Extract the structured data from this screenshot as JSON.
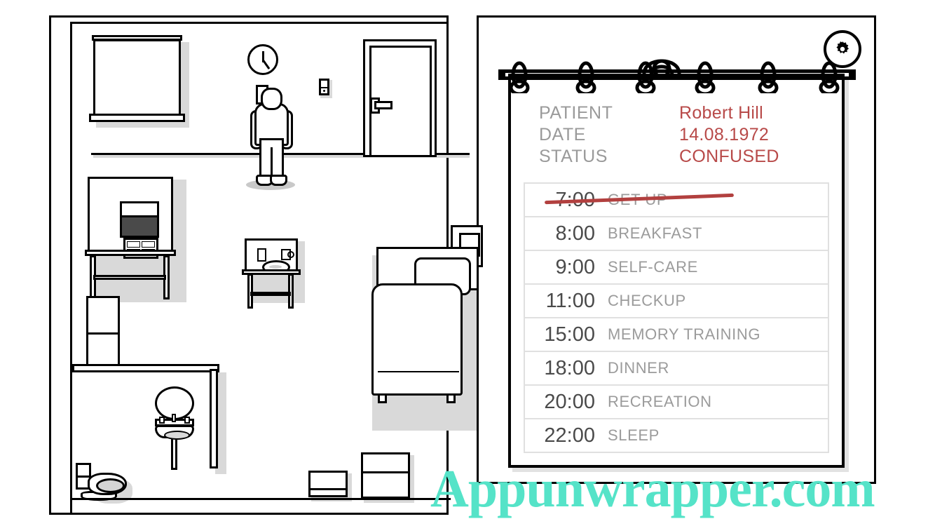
{
  "scene": {
    "left_panel_name": "hospital-room-view",
    "right_panel_name": "patient-clipboard-view"
  },
  "room": {
    "objects": [
      {
        "name": "window",
        "label": "Window"
      },
      {
        "name": "wall-clock",
        "label": "Wall clock"
      },
      {
        "name": "light-switch",
        "label": "Light switch"
      },
      {
        "name": "door",
        "label": "Door"
      },
      {
        "name": "patient-character",
        "label": "Patient"
      },
      {
        "name": "medical-machine",
        "label": "Medical machine"
      },
      {
        "name": "cabinet",
        "label": "Cabinet"
      },
      {
        "name": "bathroom-mirror",
        "label": "Mirror"
      },
      {
        "name": "sink",
        "label": "Sink"
      },
      {
        "name": "toilet",
        "label": "Toilet"
      },
      {
        "name": "dining-table",
        "label": "Table"
      },
      {
        "name": "bed",
        "label": "Bed"
      },
      {
        "name": "nightstand",
        "label": "Nightstand"
      },
      {
        "name": "box-small",
        "label": "Small box"
      },
      {
        "name": "box-large",
        "label": "Large box"
      }
    ]
  },
  "clipboard": {
    "settings_icon": "gear-icon",
    "header": [
      {
        "label": "PATIENT",
        "value": "Robert Hill"
      },
      {
        "label": "DATE",
        "value": "14.08.1972"
      },
      {
        "label": "STATUS",
        "value": "CONFUSED"
      }
    ],
    "schedule": [
      {
        "time": "7:00",
        "task": "GET UP",
        "done": true
      },
      {
        "time": "8:00",
        "task": "BREAKFAST",
        "done": false
      },
      {
        "time": "9:00",
        "task": "SELF-CARE",
        "done": false
      },
      {
        "time": "11:00",
        "task": "CHECKUP",
        "done": false
      },
      {
        "time": "15:00",
        "task": "MEMORY TRAINING",
        "done": false
      },
      {
        "time": "18:00",
        "task": "DINNER",
        "done": false
      },
      {
        "time": "20:00",
        "task": "RECREATION",
        "done": false
      },
      {
        "time": "22:00",
        "task": "SLEEP",
        "done": false
      }
    ],
    "ring_count": 6
  },
  "watermark": {
    "text": "Appunwrapper.com"
  },
  "colors": {
    "ink": "#000000",
    "paper": "#ffffff",
    "label_gray": "#9a9a9a",
    "value_red": "#b84a49",
    "time_gray": "#4a4a4a",
    "strike_red": "#b2403f",
    "row_border": "#e0e0e0",
    "shadow_gray": "#d9d9d9",
    "watermark_teal": "#55e3c8"
  }
}
